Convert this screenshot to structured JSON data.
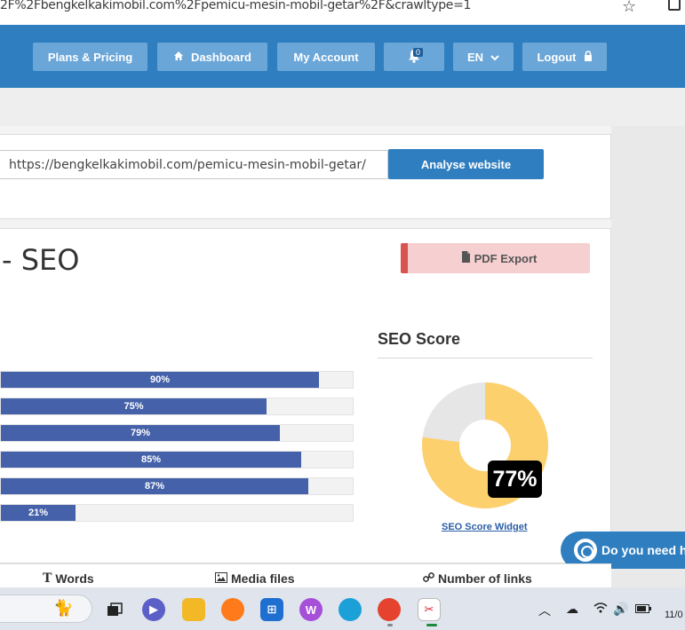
{
  "browser": {
    "url": "2F%2Fbengkelkakimobil.com%2Fpemicu-mesin-mobil-getar%2F&crawltype=1"
  },
  "nav": {
    "items": [
      {
        "label": "Plans & Pricing"
      },
      {
        "label": "Dashboard"
      },
      {
        "label": "My Account"
      },
      {
        "label": ""
      },
      {
        "label": "EN"
      },
      {
        "label": "Logout"
      }
    ],
    "notifications_count": "0"
  },
  "analyse": {
    "url_value": "https://bengkelkakimobil.com/pemicu-mesin-mobil-getar/",
    "button_label": "Analyse website"
  },
  "report": {
    "title": "- SEO",
    "pdf_label": "PDF Export",
    "score_heading": "SEO Score",
    "score_value": "77%",
    "score_fraction": 0.77,
    "widget_link": "SEO Score Widget",
    "bars": [
      {
        "label": "90%",
        "value": 90
      },
      {
        "label": "75%",
        "value": 75
      },
      {
        "label": "79%",
        "value": 79
      },
      {
        "label": "85%",
        "value": 85
      },
      {
        "label": "87%",
        "value": 87
      },
      {
        "label": "21%",
        "value": 21
      }
    ],
    "metrics": [
      "Words",
      "Media files",
      "Number of links"
    ]
  },
  "help": {
    "label": "Do you need h"
  },
  "taskbar": {
    "clock": "11/0"
  },
  "colors": {
    "brand_blue": "#2f7fc0",
    "bar_blue": "#4461a9",
    "donut_yellow": "#fdd06e",
    "donut_grey": "#e6e6e6",
    "pdf_red": "#d9534f"
  }
}
